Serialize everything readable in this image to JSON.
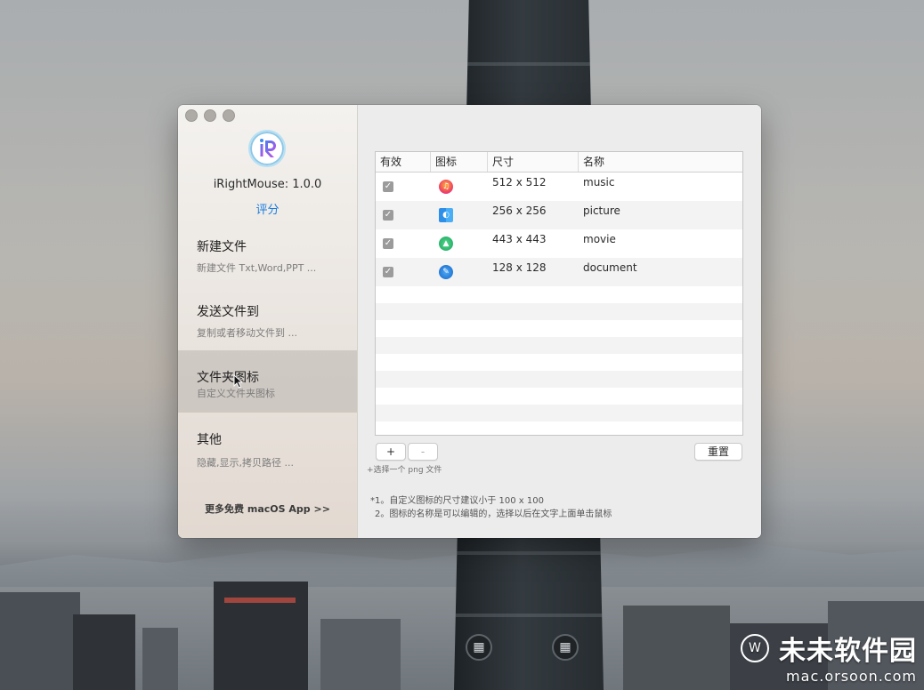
{
  "app": {
    "name_version": "iRightMouse: 1.0.0",
    "rate_label": "评分",
    "more_apps_label": "更多免费 macOS App >>"
  },
  "sidebar": {
    "items": [
      {
        "title": "新建文件",
        "subtitle": "新建文件 Txt,Word,PPT ..."
      },
      {
        "title": "发送文件到",
        "subtitle": "复制或者移动文件到 ..."
      },
      {
        "title": "文件夹图标",
        "subtitle": "自定义文件夹图标"
      },
      {
        "title": "其他",
        "subtitle": "隐藏,显示,拷贝路径 ..."
      }
    ]
  },
  "table": {
    "headers": [
      "有效",
      "图标",
      "尺寸",
      "名称"
    ],
    "rows": [
      {
        "enabled": true,
        "icon": "music-icon",
        "size": "512 x 512",
        "name": "music"
      },
      {
        "enabled": true,
        "icon": "picture-icon",
        "size": "256 x 256",
        "name": "picture"
      },
      {
        "enabled": true,
        "icon": "movie-icon",
        "size": "443 x 443",
        "name": "movie"
      },
      {
        "enabled": true,
        "icon": "document-icon",
        "size": "128 x 128",
        "name": "document"
      }
    ]
  },
  "controls": {
    "add_label": "+",
    "remove_label": "-",
    "add_hint": "+选择一个 png 文件",
    "reset_label": "重置"
  },
  "notes": [
    "*1。自定义图标的尺寸建议小于 100 x 100",
    "2。图标的名称是可以编辑的，选择以后在文字上面单击鼠标"
  ],
  "watermark": {
    "name": "未未软件园",
    "url": "mac.orsoon.com"
  },
  "colors": {
    "accent": "#1a7de0",
    "checkbox": "#9b9b9b",
    "active_nav": "#bfb9b4"
  }
}
